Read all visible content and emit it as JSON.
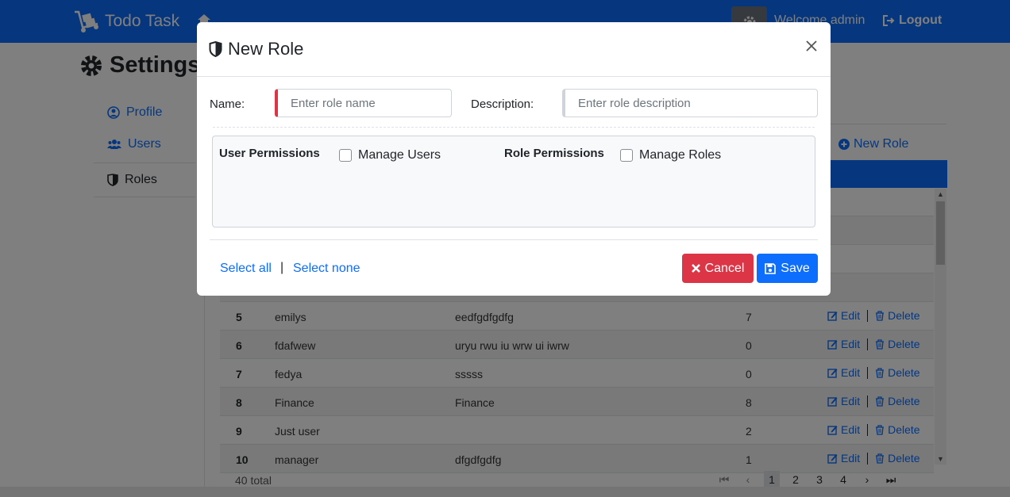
{
  "header": {
    "brand": "Todo Task",
    "welcome": "Welcome admin",
    "logout": "Logout"
  },
  "page": {
    "title": "Settings"
  },
  "sidebar": {
    "items": [
      {
        "label": "Profile",
        "icon": "user-circle-icon"
      },
      {
        "label": "Users",
        "icon": "users-icon"
      },
      {
        "label": "Roles",
        "icon": "shield-icon"
      }
    ]
  },
  "roles": {
    "new_role_link": "New Role",
    "rows": [
      {
        "id": "5",
        "name": "emilys",
        "description": "eedfgdfgdfg",
        "count": "7"
      },
      {
        "id": "6",
        "name": "fdafwew",
        "description": "uryu rwu iu wrw ui iwrw",
        "count": "0"
      },
      {
        "id": "7",
        "name": "fedya",
        "description": "sssss",
        "count": "0"
      },
      {
        "id": "8",
        "name": "Finance",
        "description": "Finance",
        "count": "8"
      },
      {
        "id": "9",
        "name": "Just user",
        "description": "",
        "count": "2"
      },
      {
        "id": "10",
        "name": "manager",
        "description": "dfgdfgdfg",
        "count": "1"
      }
    ],
    "edit_label": "Edit",
    "delete_label": "Delete",
    "total": "40 total",
    "pages": [
      "1",
      "2",
      "3",
      "4"
    ],
    "current_page": "1"
  },
  "modal": {
    "title": "New Role",
    "name_label": "Name:",
    "name_placeholder": "Enter role name",
    "description_label": "Description:",
    "description_placeholder": "Enter role description",
    "groups": [
      {
        "label": "User Permissions",
        "permission": "Manage Users"
      },
      {
        "label": "Role Permissions",
        "permission": "Manage Roles"
      }
    ],
    "select_all": "Select all",
    "select_none": "Select none",
    "separator": "|",
    "cancel": "Cancel",
    "save": "Save"
  },
  "colors": {
    "primary": "#0d6efd",
    "danger": "#dc3545"
  }
}
